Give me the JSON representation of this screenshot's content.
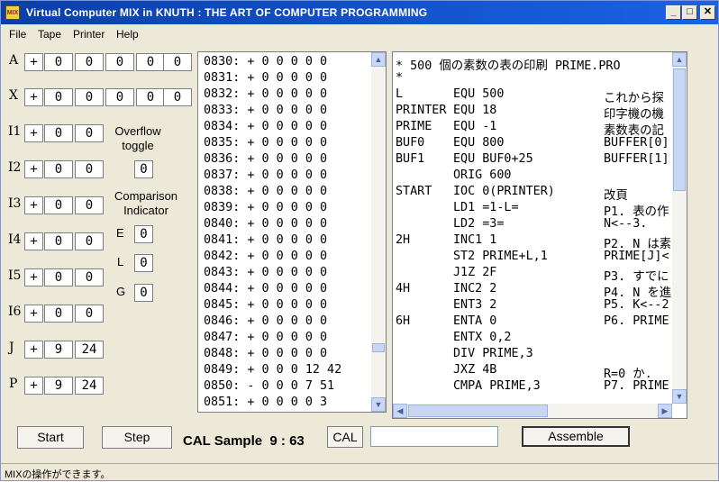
{
  "window": {
    "title": "Virtual Computer MIX in   KNUTH : THE ART OF COMPUTER PROGRAMMING",
    "icon_text": "MIX"
  },
  "menu": [
    "File",
    "Tape",
    "Printer",
    "Help"
  ],
  "registers": {
    "A": {
      "label": "A",
      "cells": [
        "+",
        "0",
        "0",
        "0",
        "0",
        "0"
      ]
    },
    "X": {
      "label": "X",
      "cells": [
        "+",
        "0",
        "0",
        "0",
        "0",
        "0"
      ]
    },
    "I1": {
      "label": "I1",
      "cells": [
        "+",
        "0",
        "0"
      ]
    },
    "I2": {
      "label": "I2",
      "cells": [
        "+",
        "0",
        "0"
      ]
    },
    "I3": {
      "label": "I3",
      "cells": [
        "+",
        "0",
        "0"
      ]
    },
    "I4": {
      "label": "I4",
      "cells": [
        "+",
        "0",
        "0"
      ]
    },
    "I5": {
      "label": "I5",
      "cells": [
        "+",
        "0",
        "0"
      ]
    },
    "I6": {
      "label": "I6",
      "cells": [
        "+",
        "0",
        "0"
      ]
    },
    "J": {
      "label": "J",
      "cells": [
        "+",
        "9",
        "24"
      ]
    },
    "P": {
      "label": "P",
      "cells": [
        "+",
        "9",
        "24"
      ]
    }
  },
  "overflow": {
    "label1": "Overflow",
    "label2": "toggle",
    "value": "0"
  },
  "comparison": {
    "label1": "Comparison",
    "label2": "Indicator",
    "E": {
      "label": "E",
      "value": "0"
    },
    "L": {
      "label": "L",
      "value": "0"
    },
    "G": {
      "label": "G",
      "value": "0"
    }
  },
  "memory": [
    "0830: + 0 0 0 0 0",
    "0831: + 0 0 0 0 0",
    "0832: + 0 0 0 0 0",
    "0833: + 0 0 0 0 0",
    "0834: + 0 0 0 0 0",
    "0835: + 0 0 0 0 0",
    "0836: + 0 0 0 0 0",
    "0837: + 0 0 0 0 0",
    "0838: + 0 0 0 0 0",
    "0839: + 0 0 0 0 0",
    "0840: + 0 0 0 0 0",
    "0841: + 0 0 0 0 0",
    "0842: + 0 0 0 0 0",
    "0843: + 0 0 0 0 0",
    "0844: + 0 0 0 0 0",
    "0845: + 0 0 0 0 0",
    "0846: + 0 0 0 0 0",
    "0847: + 0 0 0 0 0",
    "0848: + 0 0 0 0 0",
    "0849: + 0 0 0 12 42",
    "0850: - 0 0 0 7 51",
    "0851: + 0 0 0 0 3"
  ],
  "source": [
    {
      "label": "* 500 個の素数の表の印刷 PRIME.PRO",
      "op": "",
      "comment": ""
    },
    {
      "label": "*",
      "op": "",
      "comment": ""
    },
    {
      "label": "L",
      "op": "EQU 500",
      "comment": "これから探"
    },
    {
      "label": "PRINTER",
      "op": "EQU 18",
      "comment": "印字機の機"
    },
    {
      "label": "PRIME",
      "op": "EQU -1",
      "comment": "素数表の記"
    },
    {
      "label": "BUF0",
      "op": "EQU 800",
      "comment": "BUFFER[0]"
    },
    {
      "label": "BUF1",
      "op": "EQU BUF0+25",
      "comment": "BUFFER[1]"
    },
    {
      "label": "",
      "op": "ORIG 600",
      "comment": ""
    },
    {
      "label": "START",
      "op": "IOC 0(PRINTER)",
      "comment": "改頁"
    },
    {
      "label": "",
      "op": "LD1 =1-L=",
      "comment": "P1. 表の作"
    },
    {
      "label": "",
      "op": "LD2 =3=",
      "comment": "N<--3."
    },
    {
      "label": "2H",
      "op": "INC1 1",
      "comment": "P2. N は素"
    },
    {
      "label": "",
      "op": "ST2 PRIME+L,1",
      "comment": "PRIME[J]<"
    },
    {
      "label": "",
      "op": "J1Z 2F",
      "comment": "P3. すでに"
    },
    {
      "label": "4H",
      "op": "INC2 2",
      "comment": "P4. N を進"
    },
    {
      "label": "",
      "op": "ENT3 2",
      "comment": "P5. K<--2"
    },
    {
      "label": "6H",
      "op": "ENTA 0",
      "comment": "P6. PRIME"
    },
    {
      "label": "",
      "op": "ENTX 0,2",
      "comment": ""
    },
    {
      "label": "",
      "op": "DIV PRIME,3",
      "comment": ""
    },
    {
      "label": "",
      "op": "JXZ 4B",
      "comment": "R=0 か."
    },
    {
      "label": "",
      "op": "CMPA PRIME,3",
      "comment": "P7. PRIME"
    }
  ],
  "controls": {
    "start_label": "Start",
    "step_label": "Step",
    "sample_text": "CAL Sample  9 : 63",
    "cal_label": "CAL",
    "cal_input_value": "",
    "assemble_label": "Assemble"
  },
  "status": "MIXの操作ができます。"
}
